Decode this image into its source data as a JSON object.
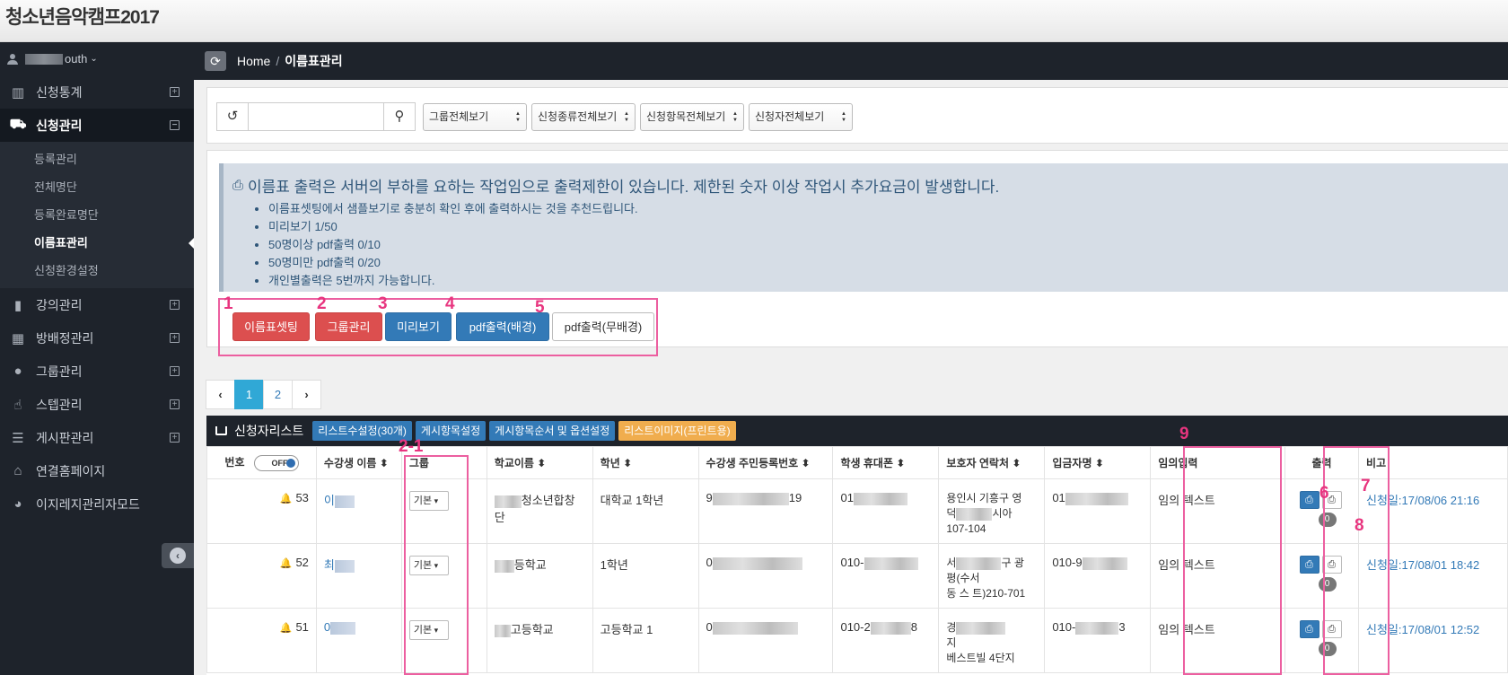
{
  "app_title": "청소년음악캠프2017",
  "user": {
    "name_suffix": "outh",
    "chevron": "⌄"
  },
  "sidebar": {
    "items": [
      {
        "label": "신청통계",
        "icon": "bar-chart-icon",
        "expand": "+"
      },
      {
        "label": "신청관리",
        "icon": "inbox-icon",
        "expand": "−"
      },
      {
        "label": "강의관리",
        "icon": "book-icon",
        "expand": "+"
      },
      {
        "label": "방배정관리",
        "icon": "building-icon",
        "expand": "+"
      },
      {
        "label": "그룹관리",
        "icon": "users-icon",
        "expand": "+"
      },
      {
        "label": "스텝관리",
        "icon": "thumbs-up-icon",
        "expand": "+"
      },
      {
        "label": "게시판관리",
        "icon": "list-icon",
        "expand": "+"
      },
      {
        "label": "연결홈페이지",
        "icon": "home-icon",
        "expand": ""
      },
      {
        "label": "이지레지관리자모드",
        "icon": "dashboard-icon",
        "expand": ""
      }
    ],
    "submenu": [
      "등록관리",
      "전체명단",
      "등록완료명단",
      "이름표관리",
      "신청환경설정"
    ]
  },
  "breadcrumb": {
    "home": "Home",
    "separator": "/",
    "current": "이름표관리"
  },
  "filters": {
    "search_placeholder": "",
    "selects": [
      "그룹전체보기",
      "신청종류전체보기",
      "신청항목전체보기",
      "신청자전체보기"
    ]
  },
  "notice": {
    "headline": "이름표 출력은 서버의 부하를 요하는 작업임으로 출력제한이 있습니다. 제한된 숫자 이상 작업시 추가요금이 발생합니다.",
    "items": [
      "이름표셋팅에서 샘플보기로 충분히 확인 후에 출력하시는 것을 추천드립니다.",
      "미리보기 1/50",
      "50명이상 pdf출력 0/10",
      "50명미만 pdf출력 0/20",
      "개인별출력은 5번까지 가능합니다."
    ]
  },
  "actions": {
    "nametag_setting": "이름표셋팅",
    "group_manage": "그룹관리",
    "preview": "미리보기",
    "pdf_bg": "pdf출력(배경)",
    "pdf_nobg": "pdf출력(무배경)"
  },
  "markers": [
    "1",
    "2",
    "3",
    "4",
    "5",
    "2-1",
    "6",
    "7",
    "8",
    "9"
  ],
  "pagination": {
    "prev": "‹",
    "pages": [
      "1",
      "2"
    ],
    "next": "›",
    "current": "1"
  },
  "list": {
    "title": "신청자리스트",
    "buttons": [
      "리스트수설정(30개)",
      "게시항목설정",
      "게시항목순서 및 옵션설정",
      "리스트이미지(프린트용)"
    ],
    "toggle": "OFF",
    "columns": [
      "번호",
      "수강생 이름 ⬍",
      "그룹",
      "학교이름 ⬍",
      "학년 ⬍",
      "수강생 주민등록번호 ⬍",
      "학생 휴대폰 ⬍",
      "보호자 연락처 ⬍",
      "입금자명 ⬍",
      "임의입력",
      "출력",
      "비고"
    ],
    "rows": [
      {
        "num": "53",
        "name": "이",
        "group": "기본",
        "school_a": "",
        "school_b": "청소년합창",
        "school_c": "단",
        "grade": "대학교 1학년",
        "rrn_a": "9",
        "rrn_b": "19",
        "phone": "01",
        "guardian_a": "용인시 기흥구 영",
        "guardian_b": "덕",
        "guardian_c": "시아",
        "guardian_d": "107-104",
        "depositor": "01",
        "custom": "임의 텍스트",
        "count": "0",
        "note": "신청일:17/08/06 21:16"
      },
      {
        "num": "52",
        "name": "최",
        "group": "기본",
        "school_a": "",
        "school_b": "등학교",
        "school_c": "",
        "grade": "1학년",
        "rrn_a": "0",
        "rrn_b": "",
        "phone": "010-",
        "guardian_a": "서",
        "guardian_b": "구 광",
        "guardian_c": "평(수서",
        "guardian_d": "동 스 트)210-701",
        "depositor": "010-9",
        "custom": "임의 텍스트",
        "count": "0",
        "note": "신청일:17/08/01 18:42"
      },
      {
        "num": "51",
        "name": "0",
        "group": "기본",
        "school_a": "",
        "school_b": "고등학교",
        "school_c": "",
        "grade": "고등학교 1",
        "rrn_a": "0",
        "rrn_b": "",
        "phone": "010-2",
        "phone_tail": "8",
        "guardian_a": "경",
        "guardian_b": "지",
        "guardian_c": "",
        "guardian_d": "베스트빌 4단지",
        "depositor": "010-",
        "depositor_tail": "3",
        "custom": "임의 텍스트",
        "count": "0",
        "note": "신청일:17/08/01 12:52"
      }
    ]
  },
  "colors": {
    "sidebar_bg": "#1e232b",
    "danger": "#dc4f4f",
    "primary": "#337ab7",
    "annotation": "#ec5fa0",
    "notice_bg": "#d6dde6"
  }
}
